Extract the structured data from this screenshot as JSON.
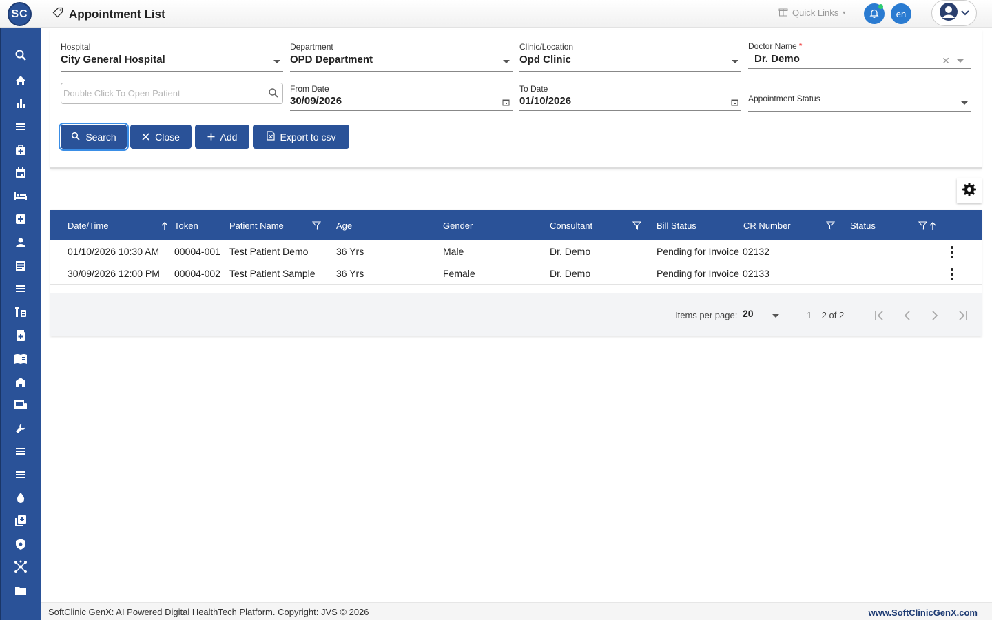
{
  "app": {
    "logo_text": "SC",
    "page_title": "Appointment List",
    "quick_links": "Quick Links",
    "language": "en"
  },
  "sidebar": {
    "icons": [
      "search-icon",
      "home-icon",
      "bar-chart-icon",
      "menu-icon",
      "medical-bag-icon",
      "calendar-icon",
      "bed-icon",
      "plus-box-icon",
      "person-icon",
      "document-icon",
      "menu-icon",
      "lab-icon",
      "pharmacy-icon",
      "book-icon",
      "store-icon",
      "devices-icon",
      "wrench-icon",
      "menu-icon",
      "menu-icon",
      "blood-drop-icon",
      "add-box-icon",
      "shield-icon",
      "network-icon",
      "folder-icon"
    ]
  },
  "filters": {
    "hospital": {
      "label": "Hospital",
      "value": "City General Hospital"
    },
    "department": {
      "label": "Department",
      "value": "OPD Department"
    },
    "clinic": {
      "label": "Clinic/Location",
      "value": "Opd Clinic"
    },
    "doctor": {
      "label": "Doctor Name",
      "required": "*",
      "value": "Dr. Demo"
    },
    "patient_search": {
      "placeholder": "Double Click To Open Patient"
    },
    "from_date": {
      "label": "From Date",
      "value": "30/09/2026"
    },
    "to_date": {
      "label": "To Date",
      "value": "01/10/2026"
    },
    "appointment_status": {
      "label": "Appointment Status"
    }
  },
  "buttons": {
    "search": "Search",
    "close": "Close",
    "add": "Add",
    "export": "Export to csv"
  },
  "table": {
    "headers": [
      "Date/Time",
      "Token",
      "Patient Name",
      "Age",
      "Gender",
      "Consultant",
      "Bill Status",
      "CR Number",
      "Status"
    ],
    "rows": [
      [
        "01/10/2026 10:30 AM",
        "00004-001",
        "Test Patient Demo",
        "36 Yrs",
        "Male",
        "Dr. Demo",
        "Pending for Invoice",
        "02132",
        ""
      ],
      [
        "30/09/2026 12:00 PM",
        "00004-002",
        "Test Patient Sample",
        "36 Yrs",
        "Female",
        "Dr. Demo",
        "Pending for Invoice",
        "02133",
        ""
      ]
    ]
  },
  "pager": {
    "items_per_page_label": "Items per page:",
    "items_per_page": "20",
    "range": "1 – 2 of 2"
  },
  "footer": {
    "copyright": "SoftClinic GenX: AI Powered Digital HealthTech Platform. Copyright: JVS © 2026",
    "website": "www.SoftClinicGenX.com"
  },
  "colors": {
    "primary": "#2a5298",
    "accent": "#2a7bd1"
  }
}
